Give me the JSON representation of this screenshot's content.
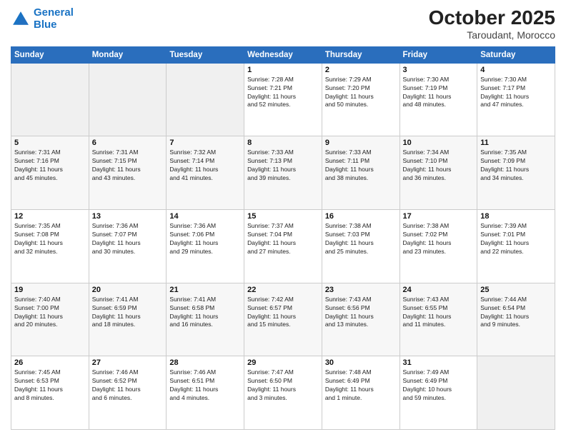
{
  "header": {
    "logo_line1": "General",
    "logo_line2": "Blue",
    "month_title": "October 2025",
    "location": "Taroudant, Morocco"
  },
  "weekdays": [
    "Sunday",
    "Monday",
    "Tuesday",
    "Wednesday",
    "Thursday",
    "Friday",
    "Saturday"
  ],
  "rows": [
    [
      {
        "day": "",
        "info": ""
      },
      {
        "day": "",
        "info": ""
      },
      {
        "day": "",
        "info": ""
      },
      {
        "day": "1",
        "info": "Sunrise: 7:28 AM\nSunset: 7:21 PM\nDaylight: 11 hours\nand 52 minutes."
      },
      {
        "day": "2",
        "info": "Sunrise: 7:29 AM\nSunset: 7:20 PM\nDaylight: 11 hours\nand 50 minutes."
      },
      {
        "day": "3",
        "info": "Sunrise: 7:30 AM\nSunset: 7:19 PM\nDaylight: 11 hours\nand 48 minutes."
      },
      {
        "day": "4",
        "info": "Sunrise: 7:30 AM\nSunset: 7:17 PM\nDaylight: 11 hours\nand 47 minutes."
      }
    ],
    [
      {
        "day": "5",
        "info": "Sunrise: 7:31 AM\nSunset: 7:16 PM\nDaylight: 11 hours\nand 45 minutes."
      },
      {
        "day": "6",
        "info": "Sunrise: 7:31 AM\nSunset: 7:15 PM\nDaylight: 11 hours\nand 43 minutes."
      },
      {
        "day": "7",
        "info": "Sunrise: 7:32 AM\nSunset: 7:14 PM\nDaylight: 11 hours\nand 41 minutes."
      },
      {
        "day": "8",
        "info": "Sunrise: 7:33 AM\nSunset: 7:13 PM\nDaylight: 11 hours\nand 39 minutes."
      },
      {
        "day": "9",
        "info": "Sunrise: 7:33 AM\nSunset: 7:11 PM\nDaylight: 11 hours\nand 38 minutes."
      },
      {
        "day": "10",
        "info": "Sunrise: 7:34 AM\nSunset: 7:10 PM\nDaylight: 11 hours\nand 36 minutes."
      },
      {
        "day": "11",
        "info": "Sunrise: 7:35 AM\nSunset: 7:09 PM\nDaylight: 11 hours\nand 34 minutes."
      }
    ],
    [
      {
        "day": "12",
        "info": "Sunrise: 7:35 AM\nSunset: 7:08 PM\nDaylight: 11 hours\nand 32 minutes."
      },
      {
        "day": "13",
        "info": "Sunrise: 7:36 AM\nSunset: 7:07 PM\nDaylight: 11 hours\nand 30 minutes."
      },
      {
        "day": "14",
        "info": "Sunrise: 7:36 AM\nSunset: 7:06 PM\nDaylight: 11 hours\nand 29 minutes."
      },
      {
        "day": "15",
        "info": "Sunrise: 7:37 AM\nSunset: 7:04 PM\nDaylight: 11 hours\nand 27 minutes."
      },
      {
        "day": "16",
        "info": "Sunrise: 7:38 AM\nSunset: 7:03 PM\nDaylight: 11 hours\nand 25 minutes."
      },
      {
        "day": "17",
        "info": "Sunrise: 7:38 AM\nSunset: 7:02 PM\nDaylight: 11 hours\nand 23 minutes."
      },
      {
        "day": "18",
        "info": "Sunrise: 7:39 AM\nSunset: 7:01 PM\nDaylight: 11 hours\nand 22 minutes."
      }
    ],
    [
      {
        "day": "19",
        "info": "Sunrise: 7:40 AM\nSunset: 7:00 PM\nDaylight: 11 hours\nand 20 minutes."
      },
      {
        "day": "20",
        "info": "Sunrise: 7:41 AM\nSunset: 6:59 PM\nDaylight: 11 hours\nand 18 minutes."
      },
      {
        "day": "21",
        "info": "Sunrise: 7:41 AM\nSunset: 6:58 PM\nDaylight: 11 hours\nand 16 minutes."
      },
      {
        "day": "22",
        "info": "Sunrise: 7:42 AM\nSunset: 6:57 PM\nDaylight: 11 hours\nand 15 minutes."
      },
      {
        "day": "23",
        "info": "Sunrise: 7:43 AM\nSunset: 6:56 PM\nDaylight: 11 hours\nand 13 minutes."
      },
      {
        "day": "24",
        "info": "Sunrise: 7:43 AM\nSunset: 6:55 PM\nDaylight: 11 hours\nand 11 minutes."
      },
      {
        "day": "25",
        "info": "Sunrise: 7:44 AM\nSunset: 6:54 PM\nDaylight: 11 hours\nand 9 minutes."
      }
    ],
    [
      {
        "day": "26",
        "info": "Sunrise: 7:45 AM\nSunset: 6:53 PM\nDaylight: 11 hours\nand 8 minutes."
      },
      {
        "day": "27",
        "info": "Sunrise: 7:46 AM\nSunset: 6:52 PM\nDaylight: 11 hours\nand 6 minutes."
      },
      {
        "day": "28",
        "info": "Sunrise: 7:46 AM\nSunset: 6:51 PM\nDaylight: 11 hours\nand 4 minutes."
      },
      {
        "day": "29",
        "info": "Sunrise: 7:47 AM\nSunset: 6:50 PM\nDaylight: 11 hours\nand 3 minutes."
      },
      {
        "day": "30",
        "info": "Sunrise: 7:48 AM\nSunset: 6:49 PM\nDaylight: 11 hours\nand 1 minute."
      },
      {
        "day": "31",
        "info": "Sunrise: 7:49 AM\nSunset: 6:49 PM\nDaylight: 10 hours\nand 59 minutes."
      },
      {
        "day": "",
        "info": ""
      }
    ]
  ]
}
